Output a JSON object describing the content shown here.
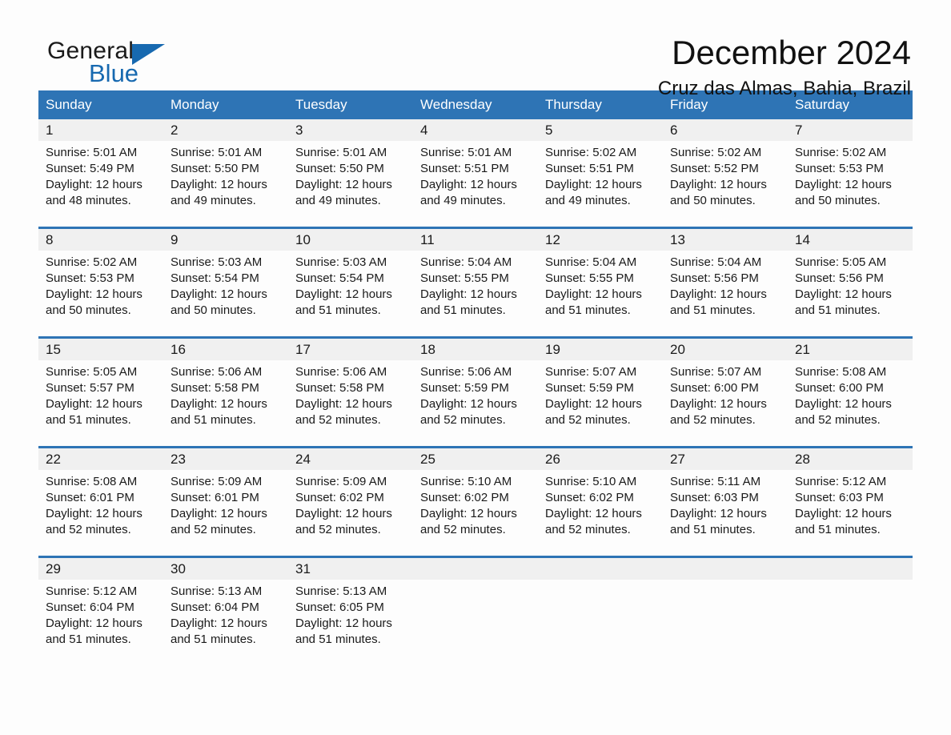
{
  "brand": {
    "name_part1": "General",
    "name_part2": "Blue",
    "flag_color": "#1769b0"
  },
  "header": {
    "title": "December 2024",
    "subtitle": "Cruz das Almas, Bahia, Brazil"
  },
  "theme": {
    "header_blue": "#2e74b5",
    "daynum_band": "#f0f0f0",
    "page_bg": "#fdfdfd",
    "text": "#1a1a1a"
  },
  "weekdays": [
    "Sunday",
    "Monday",
    "Tuesday",
    "Wednesday",
    "Thursday",
    "Friday",
    "Saturday"
  ],
  "weeks": [
    [
      {
        "day": "1",
        "sunrise": "Sunrise: 5:01 AM",
        "sunset": "Sunset: 5:49 PM",
        "daylight_1": "Daylight: 12 hours",
        "daylight_2": "and 48 minutes."
      },
      {
        "day": "2",
        "sunrise": "Sunrise: 5:01 AM",
        "sunset": "Sunset: 5:50 PM",
        "daylight_1": "Daylight: 12 hours",
        "daylight_2": "and 49 minutes."
      },
      {
        "day": "3",
        "sunrise": "Sunrise: 5:01 AM",
        "sunset": "Sunset: 5:50 PM",
        "daylight_1": "Daylight: 12 hours",
        "daylight_2": "and 49 minutes."
      },
      {
        "day": "4",
        "sunrise": "Sunrise: 5:01 AM",
        "sunset": "Sunset: 5:51 PM",
        "daylight_1": "Daylight: 12 hours",
        "daylight_2": "and 49 minutes."
      },
      {
        "day": "5",
        "sunrise": "Sunrise: 5:02 AM",
        "sunset": "Sunset: 5:51 PM",
        "daylight_1": "Daylight: 12 hours",
        "daylight_2": "and 49 minutes."
      },
      {
        "day": "6",
        "sunrise": "Sunrise: 5:02 AM",
        "sunset": "Sunset: 5:52 PM",
        "daylight_1": "Daylight: 12 hours",
        "daylight_2": "and 50 minutes."
      },
      {
        "day": "7",
        "sunrise": "Sunrise: 5:02 AM",
        "sunset": "Sunset: 5:53 PM",
        "daylight_1": "Daylight: 12 hours",
        "daylight_2": "and 50 minutes."
      }
    ],
    [
      {
        "day": "8",
        "sunrise": "Sunrise: 5:02 AM",
        "sunset": "Sunset: 5:53 PM",
        "daylight_1": "Daylight: 12 hours",
        "daylight_2": "and 50 minutes."
      },
      {
        "day": "9",
        "sunrise": "Sunrise: 5:03 AM",
        "sunset": "Sunset: 5:54 PM",
        "daylight_1": "Daylight: 12 hours",
        "daylight_2": "and 50 minutes."
      },
      {
        "day": "10",
        "sunrise": "Sunrise: 5:03 AM",
        "sunset": "Sunset: 5:54 PM",
        "daylight_1": "Daylight: 12 hours",
        "daylight_2": "and 51 minutes."
      },
      {
        "day": "11",
        "sunrise": "Sunrise: 5:04 AM",
        "sunset": "Sunset: 5:55 PM",
        "daylight_1": "Daylight: 12 hours",
        "daylight_2": "and 51 minutes."
      },
      {
        "day": "12",
        "sunrise": "Sunrise: 5:04 AM",
        "sunset": "Sunset: 5:55 PM",
        "daylight_1": "Daylight: 12 hours",
        "daylight_2": "and 51 minutes."
      },
      {
        "day": "13",
        "sunrise": "Sunrise: 5:04 AM",
        "sunset": "Sunset: 5:56 PM",
        "daylight_1": "Daylight: 12 hours",
        "daylight_2": "and 51 minutes."
      },
      {
        "day": "14",
        "sunrise": "Sunrise: 5:05 AM",
        "sunset": "Sunset: 5:56 PM",
        "daylight_1": "Daylight: 12 hours",
        "daylight_2": "and 51 minutes."
      }
    ],
    [
      {
        "day": "15",
        "sunrise": "Sunrise: 5:05 AM",
        "sunset": "Sunset: 5:57 PM",
        "daylight_1": "Daylight: 12 hours",
        "daylight_2": "and 51 minutes."
      },
      {
        "day": "16",
        "sunrise": "Sunrise: 5:06 AM",
        "sunset": "Sunset: 5:58 PM",
        "daylight_1": "Daylight: 12 hours",
        "daylight_2": "and 51 minutes."
      },
      {
        "day": "17",
        "sunrise": "Sunrise: 5:06 AM",
        "sunset": "Sunset: 5:58 PM",
        "daylight_1": "Daylight: 12 hours",
        "daylight_2": "and 52 minutes."
      },
      {
        "day": "18",
        "sunrise": "Sunrise: 5:06 AM",
        "sunset": "Sunset: 5:59 PM",
        "daylight_1": "Daylight: 12 hours",
        "daylight_2": "and 52 minutes."
      },
      {
        "day": "19",
        "sunrise": "Sunrise: 5:07 AM",
        "sunset": "Sunset: 5:59 PM",
        "daylight_1": "Daylight: 12 hours",
        "daylight_2": "and 52 minutes."
      },
      {
        "day": "20",
        "sunrise": "Sunrise: 5:07 AM",
        "sunset": "Sunset: 6:00 PM",
        "daylight_1": "Daylight: 12 hours",
        "daylight_2": "and 52 minutes."
      },
      {
        "day": "21",
        "sunrise": "Sunrise: 5:08 AM",
        "sunset": "Sunset: 6:00 PM",
        "daylight_1": "Daylight: 12 hours",
        "daylight_2": "and 52 minutes."
      }
    ],
    [
      {
        "day": "22",
        "sunrise": "Sunrise: 5:08 AM",
        "sunset": "Sunset: 6:01 PM",
        "daylight_1": "Daylight: 12 hours",
        "daylight_2": "and 52 minutes."
      },
      {
        "day": "23",
        "sunrise": "Sunrise: 5:09 AM",
        "sunset": "Sunset: 6:01 PM",
        "daylight_1": "Daylight: 12 hours",
        "daylight_2": "and 52 minutes."
      },
      {
        "day": "24",
        "sunrise": "Sunrise: 5:09 AM",
        "sunset": "Sunset: 6:02 PM",
        "daylight_1": "Daylight: 12 hours",
        "daylight_2": "and 52 minutes."
      },
      {
        "day": "25",
        "sunrise": "Sunrise: 5:10 AM",
        "sunset": "Sunset: 6:02 PM",
        "daylight_1": "Daylight: 12 hours",
        "daylight_2": "and 52 minutes."
      },
      {
        "day": "26",
        "sunrise": "Sunrise: 5:10 AM",
        "sunset": "Sunset: 6:02 PM",
        "daylight_1": "Daylight: 12 hours",
        "daylight_2": "and 52 minutes."
      },
      {
        "day": "27",
        "sunrise": "Sunrise: 5:11 AM",
        "sunset": "Sunset: 6:03 PM",
        "daylight_1": "Daylight: 12 hours",
        "daylight_2": "and 51 minutes."
      },
      {
        "day": "28",
        "sunrise": "Sunrise: 5:12 AM",
        "sunset": "Sunset: 6:03 PM",
        "daylight_1": "Daylight: 12 hours",
        "daylight_2": "and 51 minutes."
      }
    ],
    [
      {
        "day": "29",
        "sunrise": "Sunrise: 5:12 AM",
        "sunset": "Sunset: 6:04 PM",
        "daylight_1": "Daylight: 12 hours",
        "daylight_2": "and 51 minutes."
      },
      {
        "day": "30",
        "sunrise": "Sunrise: 5:13 AM",
        "sunset": "Sunset: 6:04 PM",
        "daylight_1": "Daylight: 12 hours",
        "daylight_2": "and 51 minutes."
      },
      {
        "day": "31",
        "sunrise": "Sunrise: 5:13 AM",
        "sunset": "Sunset: 6:05 PM",
        "daylight_1": "Daylight: 12 hours",
        "daylight_2": "and 51 minutes."
      },
      {
        "day": "",
        "sunrise": "",
        "sunset": "",
        "daylight_1": "",
        "daylight_2": ""
      },
      {
        "day": "",
        "sunrise": "",
        "sunset": "",
        "daylight_1": "",
        "daylight_2": ""
      },
      {
        "day": "",
        "sunrise": "",
        "sunset": "",
        "daylight_1": "",
        "daylight_2": ""
      },
      {
        "day": "",
        "sunrise": "",
        "sunset": "",
        "daylight_1": "",
        "daylight_2": ""
      }
    ]
  ]
}
